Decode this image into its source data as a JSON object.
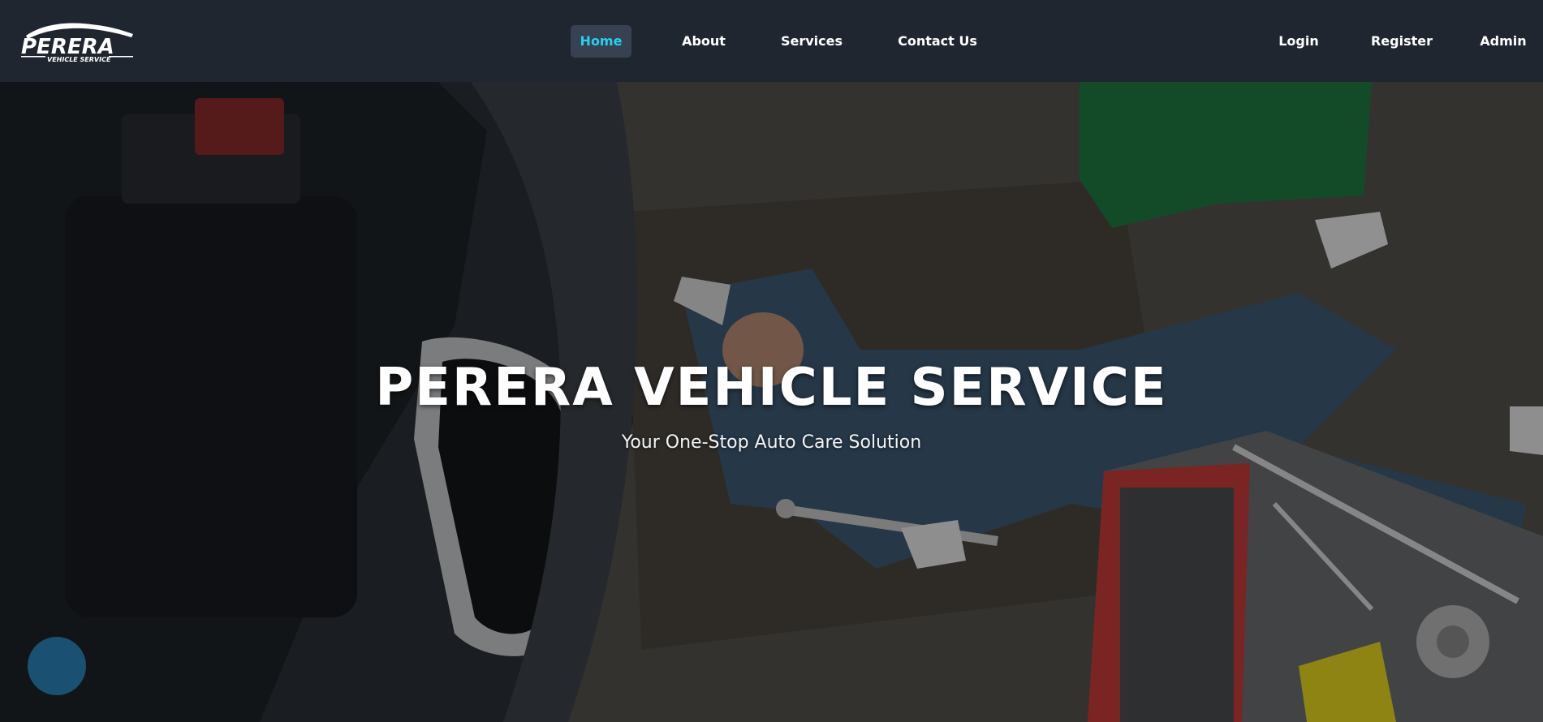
{
  "brand": {
    "logo_text": "PERERA",
    "logo_subtext": "VEHICLE SERVICE"
  },
  "nav": {
    "home": "Home",
    "about": "About",
    "services": "Services",
    "contact": "Contact Us",
    "active": "Home"
  },
  "auth": {
    "login": "Login",
    "register": "Register",
    "admin": "Admin"
  },
  "hero": {
    "title": "PERERA VEHICLE SERVICE",
    "subtitle": "Your One-Stop Auto Care Solution",
    "background_image": "mechanic lying on floor beside open car hood with toolbox"
  },
  "colors": {
    "navbar_bg": "#1f2630",
    "active_link": "#22d3ee",
    "active_bg": "#374151",
    "text": "#ffffff"
  }
}
